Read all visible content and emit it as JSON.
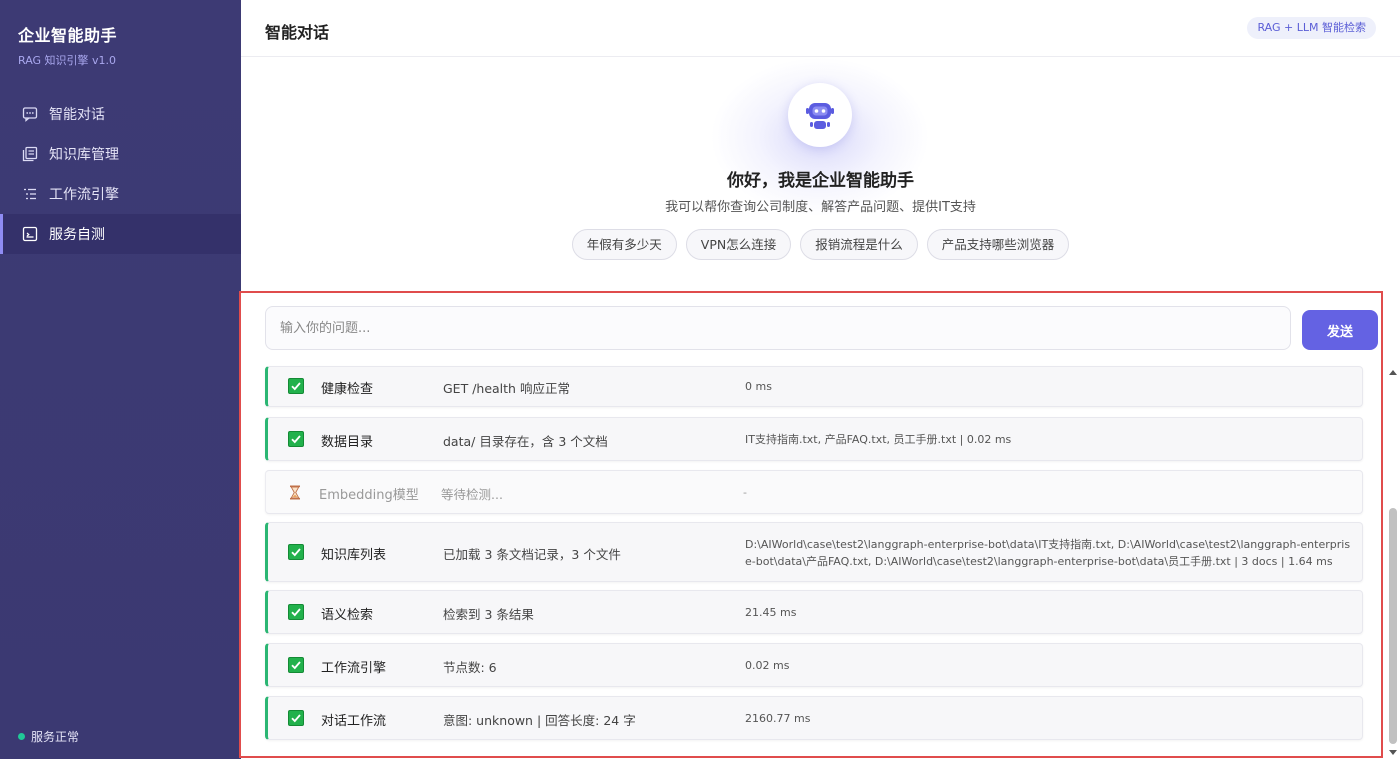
{
  "sidebar": {
    "title": "企业智能助手",
    "subtitle": "RAG 知识引擎 v1.0",
    "items": [
      {
        "label": "智能对话",
        "icon": "chat-icon"
      },
      {
        "label": "知识库管理",
        "icon": "library-icon"
      },
      {
        "label": "工作流引擎",
        "icon": "workflow-icon"
      },
      {
        "label": "服务自测",
        "icon": "test-icon",
        "active": true
      }
    ],
    "status": "服务正常"
  },
  "header": {
    "title": "智能对话",
    "badge": "RAG + LLM 智能检索"
  },
  "welcome": {
    "greeting": "你好，我是企业智能助手",
    "subtitle": "我可以帮你查询公司制度、解答产品问题、提供IT支持",
    "suggestions": [
      "年假有多少天",
      "VPN怎么连接",
      "报销流程是什么",
      "产品支持哪些浏览器"
    ]
  },
  "input": {
    "placeholder": "输入你的问题...",
    "send_label": "发送"
  },
  "checks": [
    {
      "status": "pass",
      "name": "健康检查",
      "desc": "GET /health 响应正常",
      "detail": "0 ms"
    },
    {
      "status": "pass",
      "name": "数据目录",
      "desc": "data/ 目录存在，含 3 个文档",
      "detail": "IT支持指南.txt, 产品FAQ.txt, 员工手册.txt | 0.02 ms"
    },
    {
      "status": "pending",
      "name": "Embedding模型",
      "desc": "等待检测...",
      "detail": "-"
    },
    {
      "status": "pass",
      "name": "知识库列表",
      "desc": "已加载 3 条文档记录，3 个文件",
      "detail": "D:\\AIWorld\\case\\test2\\langgraph-enterprise-bot\\data\\IT支持指南.txt, D:\\AIWorld\\case\\test2\\langgraph-enterprise-bot\\data\\产品FAQ.txt, D:\\AIWorld\\case\\test2\\langgraph-enterprise-bot\\data\\员工手册.txt | 3 docs | 1.64 ms"
    },
    {
      "status": "pass",
      "name": "语义检索",
      "desc": "检索到 3 条结果",
      "detail": "21.45 ms"
    },
    {
      "status": "pass",
      "name": "工作流引擎",
      "desc": "节点数: 6",
      "detail": "0.02 ms"
    },
    {
      "status": "pass",
      "name": "对话工作流",
      "desc": "意图: unknown | 回答长度: 24 字",
      "detail": "2160.77 ms"
    }
  ],
  "colors": {
    "sidebar_bg": "#3d3a74",
    "accent": "#6462e3",
    "pass": "#22b14c",
    "highlight_border": "#e04c4c",
    "status_dot": "#20c997"
  }
}
